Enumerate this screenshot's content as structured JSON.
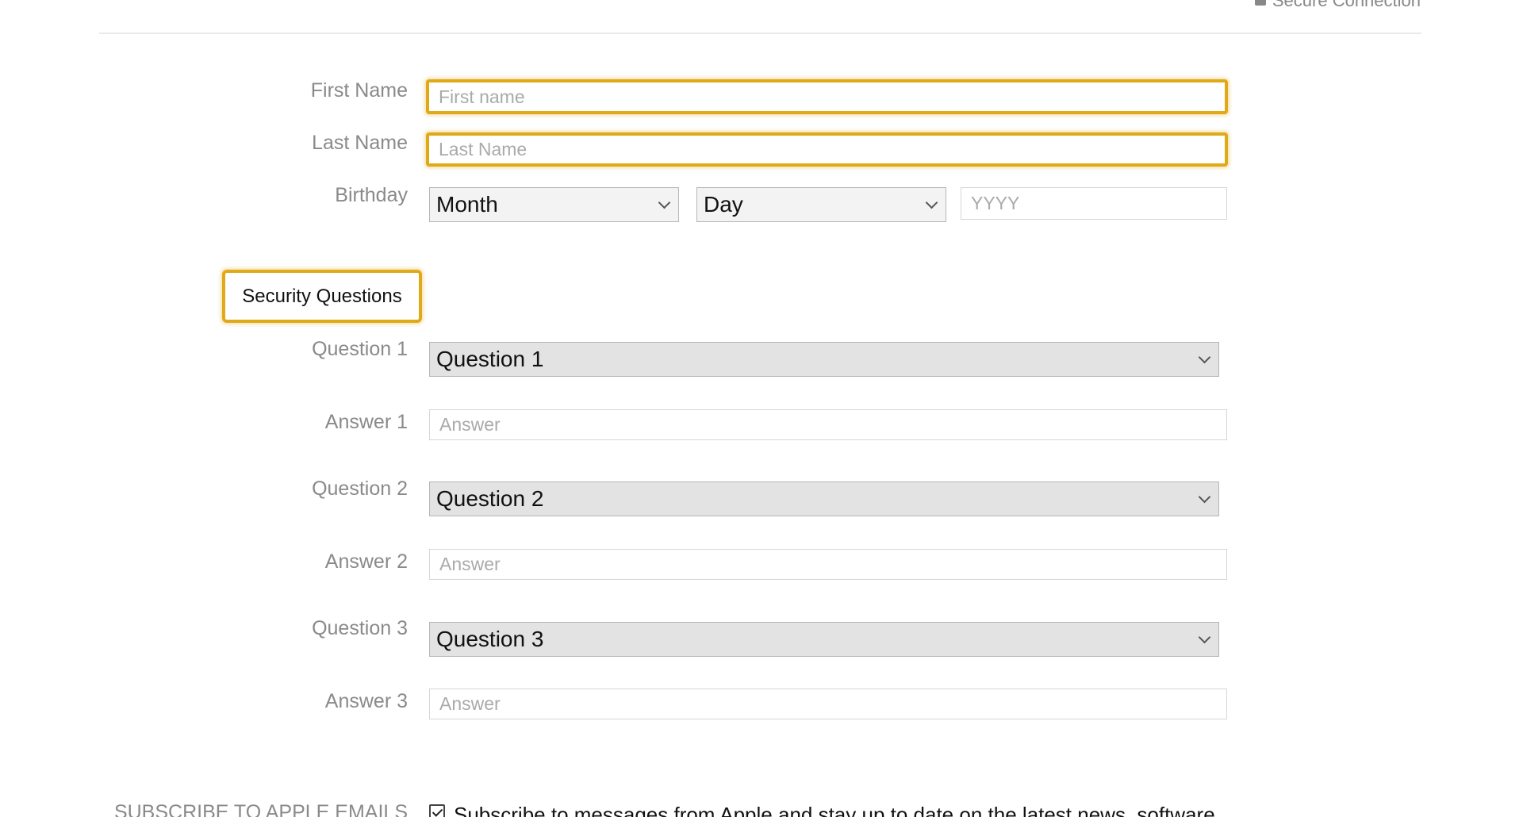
{
  "header": {
    "secure_label": "Secure Connection"
  },
  "form": {
    "first_name": {
      "label": "First Name",
      "placeholder": "First name",
      "value": ""
    },
    "last_name": {
      "label": "Last Name",
      "placeholder": "Last Name",
      "value": ""
    },
    "birthday": {
      "label": "Birthday",
      "month": "Month",
      "day": "Day",
      "year_placeholder": "YYYY"
    }
  },
  "security": {
    "heading": "Security Questions",
    "items": [
      {
        "question_label": "Question 1",
        "question_value": "Question 1",
        "answer_label": "Answer 1",
        "answer_placeholder": "Answer"
      },
      {
        "question_label": "Question 2",
        "question_value": "Question 2",
        "answer_label": "Answer 2",
        "answer_placeholder": "Answer"
      },
      {
        "question_label": "Question 3",
        "question_value": "Question 3",
        "answer_label": "Answer 3",
        "answer_placeholder": "Answer"
      }
    ]
  },
  "subscribe": {
    "label": "SUBSCRIBE TO APPLE EMAILS",
    "checked": true,
    "text": "Subscribe to messages from Apple and stay up to date on the latest news, software,"
  },
  "colors": {
    "highlight": "#e0a918",
    "label": "#8a8a8a",
    "select_background": "#e3e3e3"
  },
  "icons": {
    "secure": "lock-icon",
    "dropdown": "chevron-down-icon",
    "checkbox": "checkmark-icon"
  }
}
